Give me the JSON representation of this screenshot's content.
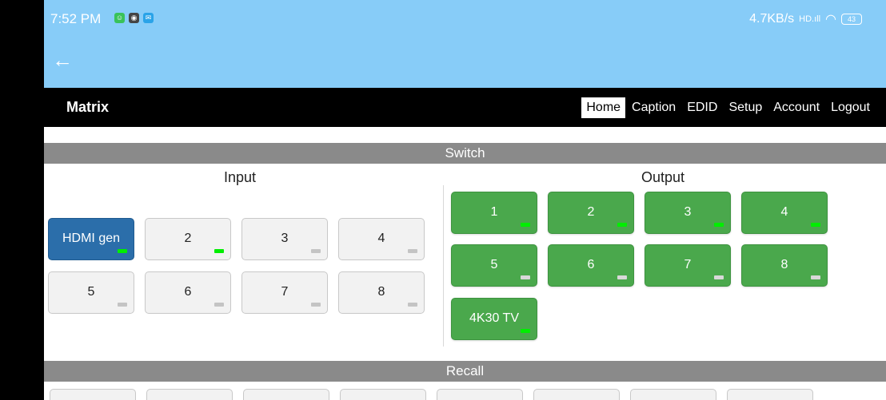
{
  "status": {
    "time": "7:52 PM",
    "icons": [
      {
        "name": "app-green-icon",
        "color": "#39c25a",
        "glyph": "☺"
      },
      {
        "name": "app-camera-icon",
        "color": "#444444",
        "glyph": "◉"
      },
      {
        "name": "app-chat-icon",
        "color": "#2aa3e8",
        "glyph": "✉"
      }
    ],
    "network_speed": "4.7KB/s",
    "signal_glyph": "HD.ıll",
    "wifi_glyph": "◠",
    "battery": "43"
  },
  "appbar": {
    "back_glyph": "←"
  },
  "nav": {
    "brand": "Matrix",
    "links": [
      "Home",
      "Caption",
      "EDID",
      "Setup",
      "Account",
      "Logout"
    ],
    "active": "Home"
  },
  "switch": {
    "section_label": "Switch",
    "input_title": "Input",
    "output_title": "Output",
    "inputs": [
      {
        "label": "HDMI gen",
        "selected": true,
        "led": "green"
      },
      {
        "label": "2",
        "selected": false,
        "led": "green"
      },
      {
        "label": "3",
        "selected": false,
        "led": "grey"
      },
      {
        "label": "4",
        "selected": false,
        "led": "grey"
      },
      {
        "label": "5",
        "selected": false,
        "led": "grey"
      },
      {
        "label": "6",
        "selected": false,
        "led": "grey"
      },
      {
        "label": "7",
        "selected": false,
        "led": "grey"
      },
      {
        "label": "8",
        "selected": false,
        "led": "grey"
      }
    ],
    "outputs": [
      {
        "label": "1",
        "led": "green"
      },
      {
        "label": "2",
        "led": "green"
      },
      {
        "label": "3",
        "led": "green"
      },
      {
        "label": "4",
        "led": "green"
      },
      {
        "label": "5",
        "led": "grey"
      },
      {
        "label": "6",
        "led": "grey"
      },
      {
        "label": "7",
        "led": "grey"
      },
      {
        "label": "8",
        "led": "grey"
      },
      {
        "label": "4K30 TV",
        "led": "green"
      }
    ]
  },
  "recall": {
    "section_label": "Recall",
    "slot_count": 8
  },
  "colors": {
    "statusbar": "#87ccf8",
    "selected_input": "#2b6eaa",
    "output_button": "#4aa84c",
    "led_on": "#00ee00",
    "led_off": "#c4c4c4",
    "section_bar": "#8a8a8a"
  }
}
